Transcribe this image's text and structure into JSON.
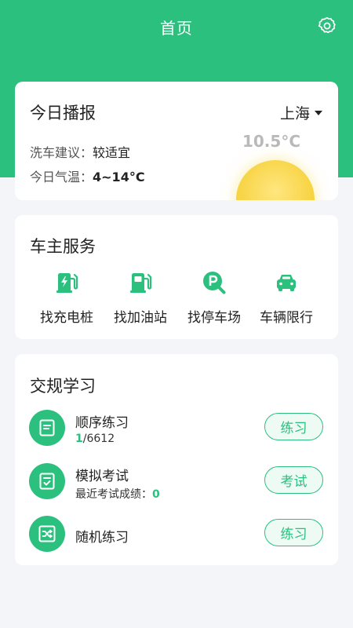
{
  "header": {
    "title": "首页",
    "settings_icon": "gear-icon"
  },
  "weather": {
    "title": "今日播报",
    "city": "上海",
    "wash_label": "洗车建议：",
    "wash_value": "较适宜",
    "temp_label": "今日气温：",
    "temp_range": "4~14°C",
    "current_temp": "10.5°C"
  },
  "services": {
    "title": "车主服务",
    "items": [
      {
        "label": "找充电桩",
        "icon": "charging-station-icon"
      },
      {
        "label": "找加油站",
        "icon": "gas-station-icon"
      },
      {
        "label": "找停车场",
        "icon": "parking-search-icon"
      },
      {
        "label": "车辆限行",
        "icon": "car-icon"
      }
    ]
  },
  "study": {
    "title": "交规学习",
    "items": [
      {
        "name": "顺序练习",
        "progress_done": "1",
        "progress_total": "/6612",
        "button": "练习",
        "icon": "document-icon"
      },
      {
        "name": "模拟考试",
        "score_label": "最近考试成绩：",
        "score": "0",
        "button": "考试",
        "icon": "checklist-icon"
      },
      {
        "name": "随机练习",
        "button": "练习",
        "icon": "shuffle-icon"
      }
    ]
  },
  "colors": {
    "brand": "#2cc07f",
    "background": "#f4f5f9",
    "sun": "#f6d13a"
  }
}
